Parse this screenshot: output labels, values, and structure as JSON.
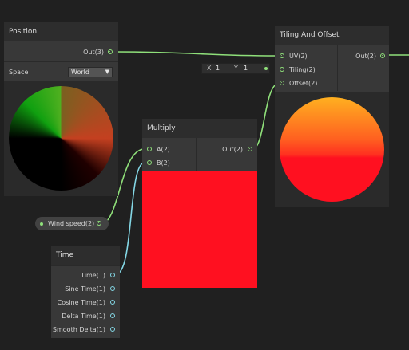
{
  "nodes": {
    "position": {
      "title": "Position",
      "out_label": "Out(3)",
      "space_label": "Space",
      "space_value": "World"
    },
    "tiling_offset": {
      "title": "Tiling And Offset",
      "inputs": [
        "UV(2)",
        "Tiling(2)",
        "Offset(2)"
      ],
      "out_label": "Out(2)",
      "tiling_x_label": "X",
      "tiling_x_value": "1",
      "tiling_y_label": "Y",
      "tiling_y_value": "1"
    },
    "multiply": {
      "title": "Multiply",
      "inputs": [
        "A(2)",
        "B(2)"
      ],
      "out_label": "Out(2)",
      "preview_color": "#ff1020"
    },
    "wind_speed": {
      "label": "Wind speed(2)"
    },
    "time": {
      "title": "Time",
      "outputs": [
        "Time(1)",
        "Sine Time(1)",
        "Cosine Time(1)",
        "Delta Time(1)",
        "Smooth Delta(1)"
      ]
    }
  },
  "colors": {
    "canvas": "#202020",
    "node_body": "#383838",
    "node_header": "#2d2d2d",
    "wire_green": "#8fe07a",
    "wire_cyan": "#84d8e6"
  }
}
